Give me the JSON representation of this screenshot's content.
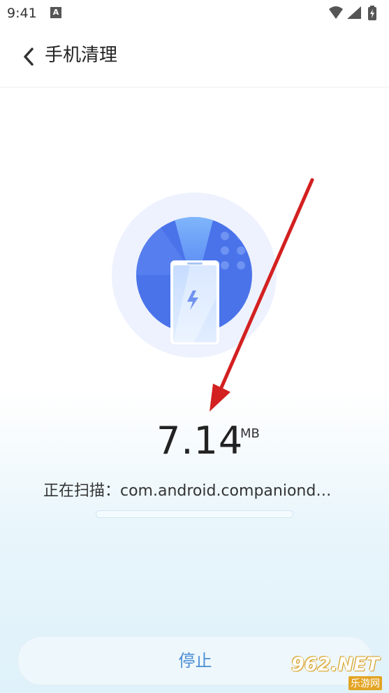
{
  "status_bar": {
    "time": "9:41",
    "notification_icon": "A",
    "icons": [
      "wifi-icon",
      "signal-icon",
      "battery-charging-icon"
    ]
  },
  "header": {
    "back_icon": "chevron-left-icon",
    "title": "手机清理"
  },
  "scan": {
    "size_value": "7.14",
    "size_unit": "MB",
    "status_text": "正在扫描：com.android.companiond…",
    "progress": 0.0
  },
  "actions": {
    "stop_label": "停止"
  },
  "watermark": {
    "logo": "962.NET",
    "subtitle": "乐游网"
  },
  "colors": {
    "accent": "#4a8ed6",
    "circle_outer": "#eef2fe",
    "circle_inner": "#4a73ea",
    "arrow": "#d32020"
  }
}
